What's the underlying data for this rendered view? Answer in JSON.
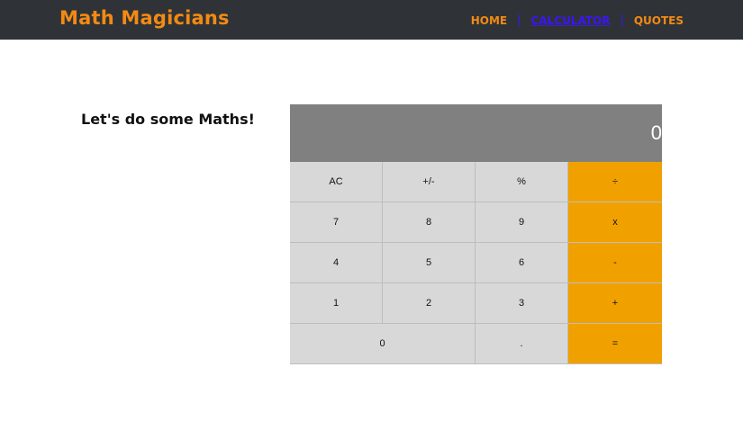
{
  "header": {
    "brand": "Math Magicians",
    "nav": {
      "home": "HOME",
      "separator_1": "|",
      "calculator": "CALCULATOR",
      "separator_2": "|",
      "quotes": "QUOTES"
    },
    "active_item": "calculator"
  },
  "main": {
    "heading": "Let's do some Maths!"
  },
  "calculator": {
    "display": "0",
    "keys": {
      "ac": "AC",
      "sign": "+/-",
      "percent": "%",
      "divide": "÷",
      "seven": "7",
      "eight": "8",
      "nine": "9",
      "multiply": "x",
      "four": "4",
      "five": "5",
      "six": "6",
      "subtract": "-",
      "one": "1",
      "two": "2",
      "three": "3",
      "add": "+",
      "zero": "0",
      "decimal": ".",
      "equals": "="
    }
  },
  "colors": {
    "navbar_bg": "#2f3337",
    "brand": "#f38a13",
    "active_link": "#3a16f2",
    "display_bg": "#808080",
    "key_bg": "#d8d8d8",
    "operator_bg": "#f0a100"
  }
}
